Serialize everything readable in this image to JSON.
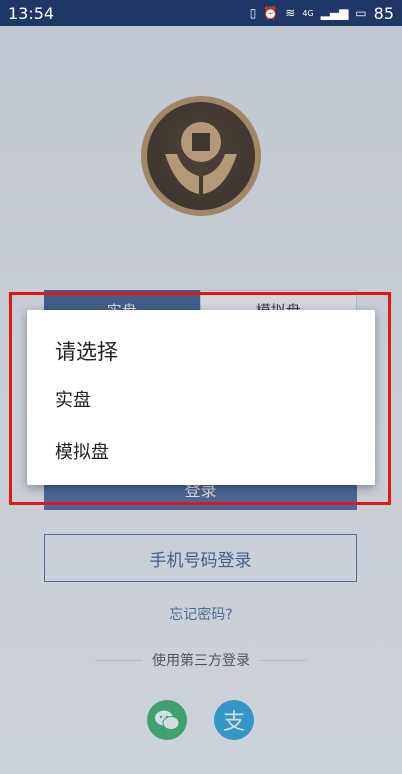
{
  "status_bar": {
    "time": "13:54",
    "network_label": "4G",
    "battery": "85"
  },
  "tabs": {
    "real": "实盘",
    "simulated": "模拟盘"
  },
  "buttons": {
    "login": "登录",
    "phone_login": "手机号码登录"
  },
  "links": {
    "forgot_password": "忘记密码?",
    "third_party": "使用第三方登录"
  },
  "social": {
    "alipay_glyph": "支"
  },
  "dialog": {
    "title": "请选择",
    "options": [
      "实盘",
      "模拟盘"
    ]
  },
  "colors": {
    "status_bar": "#1f3766",
    "primary": "#2f4f86",
    "highlight_border": "#e0161b",
    "wechat": "#2aae67",
    "alipay": "#1a9fdd"
  }
}
